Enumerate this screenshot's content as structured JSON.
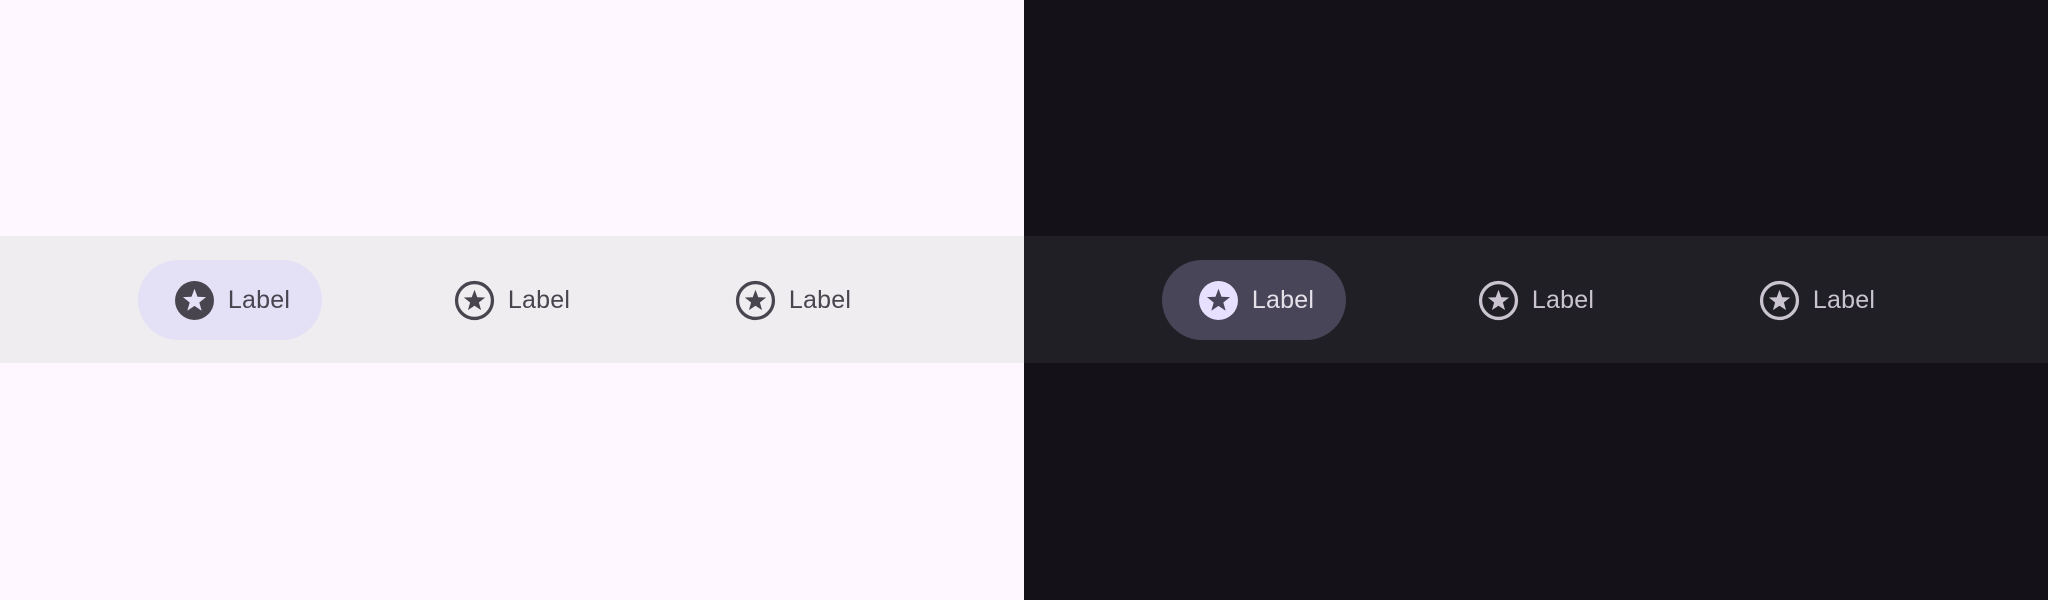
{
  "light": {
    "nav_items": [
      {
        "label": "Label",
        "icon": "star-circle-icon",
        "active": true
      },
      {
        "label": "Label",
        "icon": "star-circle-outline-icon",
        "active": false
      },
      {
        "label": "Label",
        "icon": "star-circle-outline-icon",
        "active": false
      }
    ]
  },
  "dark": {
    "nav_items": [
      {
        "label": "Label",
        "icon": "star-circle-icon",
        "active": true
      },
      {
        "label": "Label",
        "icon": "star-circle-outline-icon",
        "active": false
      },
      {
        "label": "Label",
        "icon": "star-circle-outline-icon",
        "active": false
      }
    ]
  },
  "colors": {
    "light_background": "#FEF7FF",
    "light_nav_bar": "#F0EDF1",
    "light_active_indicator": "#E4E0F6",
    "light_icon": "#49454F",
    "dark_background": "#141218",
    "dark_nav_bar": "#211F26",
    "dark_active_indicator": "#484559",
    "dark_icon": "#CAC4D0",
    "dark_active_icon": "#E8E0FF"
  }
}
